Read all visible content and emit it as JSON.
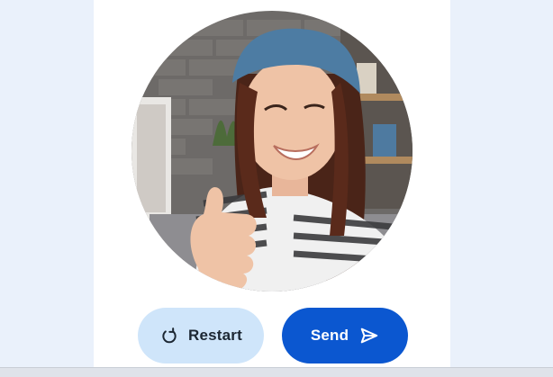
{
  "actions": {
    "restart_label": "Restart",
    "send_label": "Send"
  },
  "photo": {
    "subject": "portrait-thumbs-up"
  },
  "icons": {
    "restart": "restart-icon",
    "send": "send-icon"
  },
  "colors": {
    "page_background": "#eaf1fb",
    "panel": "#ffffff",
    "restart_button": "#cfe5fa",
    "send_button": "#0b57d0"
  }
}
